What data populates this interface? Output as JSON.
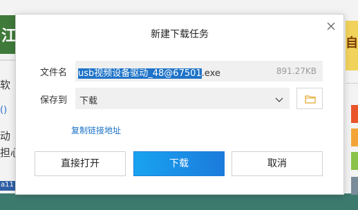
{
  "background": {
    "left_banner_text": "江",
    "left_text_1": "软",
    "left_link": "()",
    "left_text_2": "动",
    "left_text_3": "担心",
    "left_bottom_text": "a11",
    "right_banner_text": "自",
    "right_swatches": [
      "#e8532a",
      "#f2a437",
      "#8bc34a",
      "#7a8c9a"
    ]
  },
  "dialog": {
    "title": "新建下载任务",
    "file": {
      "label": "文件名",
      "name_selected": "usb视频设备驱动_48@67501",
      "name_extension": ".exe",
      "size": "891.27KB"
    },
    "save": {
      "label": "保存到",
      "value": "下载"
    },
    "copy_link": "复制链接地址",
    "buttons": {
      "open_direct": "直接打开",
      "download": "下载",
      "cancel": "取消"
    }
  },
  "colors": {
    "accent": "#1b7bdc",
    "selection": "#1e73c8",
    "link": "#1a73c8"
  },
  "icons": {
    "close": "close-icon",
    "dropdown": "chevron-down-icon",
    "folder": "folder-icon"
  }
}
